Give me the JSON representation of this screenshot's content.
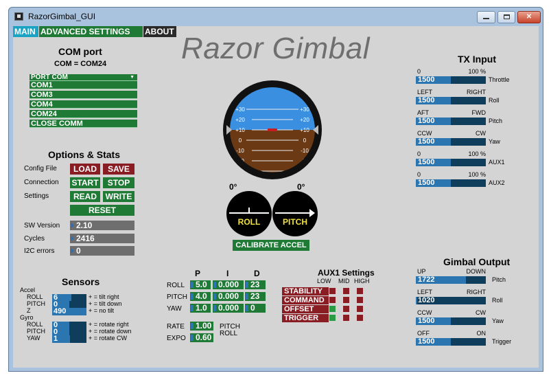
{
  "window": {
    "title": "RazorGimbal_GUI",
    "close_glyph": "✕"
  },
  "tabs": [
    {
      "label": "MAIN",
      "color": "#1aa3c2"
    },
    {
      "label": "ADVANCED SETTINGS",
      "color": "#1e7a35"
    },
    {
      "label": "ABOUT",
      "color": "#2a2a2a"
    }
  ],
  "app_title": "Razor Gimbal",
  "com": {
    "title": "COM port",
    "status": "COM = COM24",
    "dropdown_label": "PORT COM",
    "items": [
      "COM1",
      "COM3",
      "COM4",
      "COM24",
      "CLOSE COMM"
    ]
  },
  "options": {
    "title": "Options & Stats",
    "config_file": "Config File",
    "load": "LOAD",
    "save": "SAVE",
    "connection": "Connection",
    "start": "START",
    "stop": "STOP",
    "settings": "Settings",
    "read": "READ",
    "write": "WRITE",
    "reset": "RESET",
    "sw_version_label": "SW Version",
    "sw_version": "2.10",
    "cycles_label": "Cycles",
    "cycles": "2416",
    "i2c_label": "I2C errors",
    "i2c": "0"
  },
  "sensors": {
    "title": "Sensors",
    "accel_label": "Accel",
    "gyro_label": "Gyro",
    "accel": [
      {
        "axis": "ROLL",
        "value": "6",
        "hint": "+ = tilt right",
        "level": 0.55
      },
      {
        "axis": "PITCH",
        "value": "0",
        "hint": "+ = tilt down",
        "level": 0.5
      },
      {
        "axis": "Z",
        "value": "490",
        "hint": "+ = no tilt",
        "level": 1.0
      }
    ],
    "gyro": [
      {
        "axis": "ROLL",
        "value": "0",
        "hint": "+ = rotate right",
        "level": 0.5
      },
      {
        "axis": "PITCH",
        "value": "0",
        "hint": "+ = rotate down",
        "level": 0.5
      },
      {
        "axis": "YAW",
        "value": "1",
        "hint": "+ = rotate CW",
        "level": 0.52
      }
    ]
  },
  "horizon": {
    "ticks": [
      "+30",
      "+20",
      "+10",
      "0",
      "-10",
      "-20",
      "-30"
    ],
    "sky_color": "#3b8fe0",
    "ground_color": "#6b3a15",
    "roll_label": "ROLL",
    "pitch_label": "PITCH",
    "roll_deg": "0°",
    "pitch_deg": "0°",
    "calibrate": "CALIBRATE  ACCEL"
  },
  "pid": {
    "headers": [
      "P",
      "I",
      "D"
    ],
    "rows": [
      {
        "axis": "ROLL",
        "p": "5.0",
        "i": "0.000",
        "d": "23"
      },
      {
        "axis": "PITCH",
        "p": "4.0",
        "i": "0.000",
        "d": "23"
      },
      {
        "axis": "YAW",
        "p": "1.0",
        "i": "0.000",
        "d": "0"
      }
    ],
    "rate_label": "RATE",
    "rate": "1.00",
    "expo_label": "EXPO",
    "expo": "0.60",
    "rate_pitch": "PITCH",
    "rate_roll": "ROLL"
  },
  "aux1": {
    "title": "AUX1 Settings",
    "cols": [
      "LOW",
      "MID",
      "HIGH"
    ],
    "rows": [
      {
        "label": "STABILITY",
        "states": [
          "red",
          "red",
          "red"
        ]
      },
      {
        "label": "COMMAND",
        "states": [
          "red",
          "red",
          "red"
        ]
      },
      {
        "label": "OFFSET",
        "states": [
          "green",
          "red",
          "red"
        ]
      },
      {
        "label": "TRIGGER",
        "states": [
          "green",
          "red",
          "red"
        ]
      }
    ]
  },
  "tx": {
    "title": "TX Input",
    "channels": [
      {
        "left": "0",
        "right": "100 %",
        "value": "1500",
        "name": "Throttle",
        "level": 0.5
      },
      {
        "left": "LEFT",
        "right": "RIGHT",
        "value": "1500",
        "name": "Roll",
        "level": 0.5
      },
      {
        "left": "AFT",
        "right": "FWD",
        "value": "1500",
        "name": "Pitch",
        "level": 0.5
      },
      {
        "left": "CCW",
        "right": "CW",
        "value": "1500",
        "name": "Yaw",
        "level": 0.5
      },
      {
        "left": "0",
        "right": "100 %",
        "value": "1500",
        "name": "AUX1",
        "level": 0.5
      },
      {
        "left": "0",
        "right": "100 %",
        "value": "1500",
        "name": "AUX2",
        "level": 0.5
      }
    ]
  },
  "gimbal": {
    "title": "Gimbal Output",
    "channels": [
      {
        "left": "UP",
        "right": "DOWN",
        "value": "1722",
        "name": "Pitch",
        "level": 0.72
      },
      {
        "left": "LEFT",
        "right": "RIGHT",
        "value": "1020",
        "name": "Roll",
        "level": 0.02
      },
      {
        "left": "CCW",
        "right": "CW",
        "value": "1500",
        "name": "Yaw",
        "level": 0.5
      },
      {
        "left": "OFF",
        "right": "ON",
        "value": "1500",
        "name": "Trigger",
        "level": 0.5
      }
    ]
  }
}
